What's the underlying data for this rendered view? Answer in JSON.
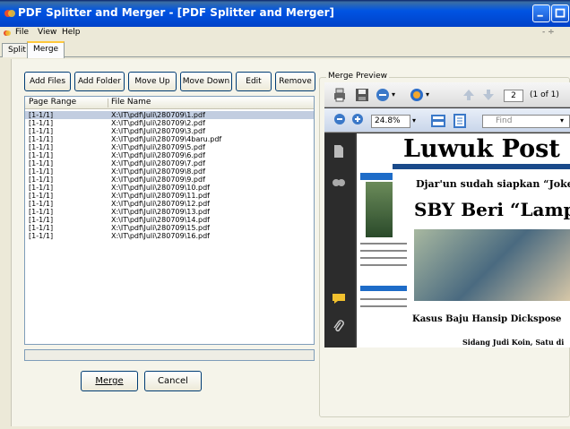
{
  "window": {
    "title": "PDF Splitter and  Merger - [PDF Splitter and Merger]"
  },
  "menu": {
    "items": [
      "File",
      "View",
      "Help"
    ],
    "mdi_controls": "- ÷"
  },
  "tabs": [
    {
      "label": "Split",
      "active": false
    },
    {
      "label": "Merge",
      "active": true
    }
  ],
  "toolbar": {
    "add_files": "Add Files",
    "add_folder": "Add Folder",
    "move_up": "Move Up",
    "move_down": "Move Down",
    "edit": "Edit",
    "remove": "Remove"
  },
  "list": {
    "columns": [
      "Page Range",
      "File Name"
    ],
    "rows": [
      {
        "range": "[1-1/1]",
        "file": "X:\\IT\\pdf\\Juli\\280709\\1.pdf",
        "selected": true
      },
      {
        "range": "[1-1/1]",
        "file": "X:\\IT\\pdf\\Juli\\280709\\2.pdf"
      },
      {
        "range": "[1-1/1]",
        "file": "X:\\IT\\pdf\\Juli\\280709\\3.pdf"
      },
      {
        "range": "[1-1/1]",
        "file": "X:\\IT\\pdf\\Juli\\280709\\4baru.pdf"
      },
      {
        "range": "[1-1/1]",
        "file": "X:\\IT\\pdf\\Juli\\280709\\5.pdf"
      },
      {
        "range": "[1-1/1]",
        "file": "X:\\IT\\pdf\\Juli\\280709\\6.pdf"
      },
      {
        "range": "[1-1/1]",
        "file": "X:\\IT\\pdf\\Juli\\280709\\7.pdf"
      },
      {
        "range": "[1-1/1]",
        "file": "X:\\IT\\pdf\\Juli\\280709\\8.pdf"
      },
      {
        "range": "[1-1/1]",
        "file": "X:\\IT\\pdf\\Juli\\280709\\9.pdf"
      },
      {
        "range": "[1-1/1]",
        "file": "X:\\IT\\pdf\\Juli\\280709\\10.pdf"
      },
      {
        "range": "[1-1/1]",
        "file": "X:\\IT\\pdf\\Juli\\280709\\11.pdf"
      },
      {
        "range": "[1-1/1]",
        "file": "X:\\IT\\pdf\\Juli\\280709\\12.pdf"
      },
      {
        "range": "[1-1/1]",
        "file": "X:\\IT\\pdf\\Juli\\280709\\13.pdf"
      },
      {
        "range": "[1-1/1]",
        "file": "X:\\IT\\pdf\\Juli\\280709\\14.pdf"
      },
      {
        "range": "[1-1/1]",
        "file": "X:\\IT\\pdf\\Juli\\280709\\15.pdf"
      },
      {
        "range": "[1-1/1]",
        "file": "X:\\IT\\pdf\\Juli\\280709\\16.pdf"
      }
    ]
  },
  "actions": {
    "merge": "Merge",
    "cancel": "Cancel"
  },
  "preview": {
    "group_label": "Merge Preview",
    "page_number": "2",
    "page_count": "(1 of 1)",
    "zoom": "24.8%",
    "find_placeholder": "Find",
    "newspaper": {
      "masthead": "Luwuk Post",
      "headline1": "Djar'un sudah siapkan “Joker”",
      "headline2": "SBY Beri “Lampu I",
      "headline3": "Kasus Baju Hansip Dickspose",
      "headline4": "Sidang Judi Koin, Satu di"
    }
  },
  "colors": {
    "titlebar": "#0054e3",
    "tab_highlight": "#ffc83c",
    "selection": "#c2cde0"
  }
}
